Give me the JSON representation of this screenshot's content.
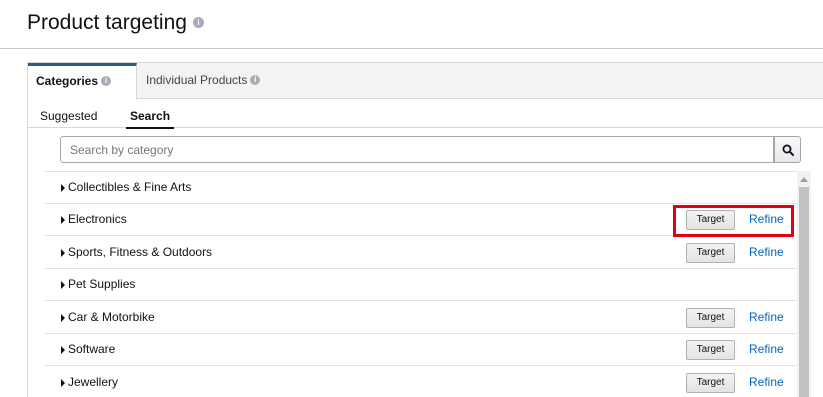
{
  "header": {
    "title": "Product targeting",
    "info_icon": "info-icon"
  },
  "tabs": [
    {
      "label": "Categories",
      "active": true
    },
    {
      "label": "Individual Products",
      "active": false
    }
  ],
  "subtabs": [
    {
      "label": "Suggested",
      "active": false
    },
    {
      "label": "Search",
      "active": true
    }
  ],
  "search": {
    "placeholder": "Search by category",
    "value": "",
    "button_icon": "search-icon"
  },
  "categories": [
    {
      "name": "Collectibles & Fine Arts",
      "has_actions": false
    },
    {
      "name": "Electronics",
      "has_actions": true,
      "target_label": "Target",
      "refine_label": "Refine",
      "highlighted": true
    },
    {
      "name": "Sports, Fitness & Outdoors",
      "has_actions": true,
      "target_label": "Target",
      "refine_label": "Refine"
    },
    {
      "name": "Pet Supplies",
      "has_actions": false
    },
    {
      "name": "Car & Motorbike",
      "has_actions": true,
      "target_label": "Target",
      "refine_label": "Refine"
    },
    {
      "name": "Software",
      "has_actions": true,
      "target_label": "Target",
      "refine_label": "Refine"
    },
    {
      "name": "Jewellery",
      "has_actions": true,
      "target_label": "Target",
      "refine_label": "Refine"
    }
  ],
  "colors": {
    "link": "#0066c0",
    "highlight": "#e3000f",
    "active_tab_border": "#2d5b8a"
  }
}
